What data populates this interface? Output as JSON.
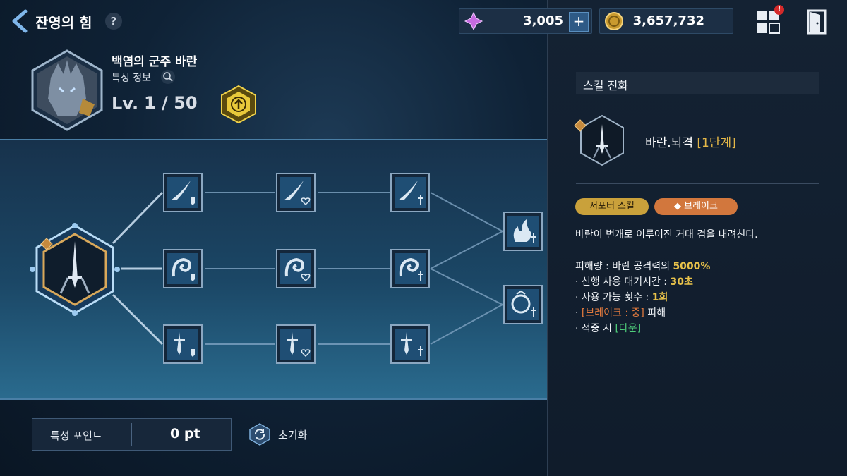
{
  "header": {
    "title": "잔영의 힘",
    "help_label": "?",
    "currency_gem": "3,005",
    "currency_gem_add": "+",
    "currency_gold": "3,657,732",
    "menu_badge": "!"
  },
  "hero": {
    "name": "백염의 군주 바란",
    "sub_label": "특성 정보",
    "level_label": "Lv.",
    "level_value": "1 / 50"
  },
  "bottom": {
    "points_label": "특성 포인트",
    "points_value": "0 pt",
    "reset_label": "초기화"
  },
  "skill_panel": {
    "header": "스킬 진화",
    "skill_name": "바란.뇌격",
    "skill_level": "[1단계]",
    "tag_support": "서포터 스킬",
    "tag_break": "브레이크",
    "description": "바란이 번개로 이루어진 거대 검을 내려친다.",
    "damage_label": "피해량 : 바란 공격력의 ",
    "damage_value": "5000%",
    "cooldown_label": "· 선행 사용 대기시간 : ",
    "cooldown_value": "30초",
    "uses_label": "· 사용 가능 횟수 : ",
    "uses_value": "1회",
    "break_prefix": "· ",
    "break_value": "[브레이크 : 중]",
    "break_suffix": " 피해",
    "hit_label": "· 적중 시 ",
    "hit_value": "[다운]"
  },
  "colors": {
    "accent_gold": "#e8c24a",
    "break_orange": "#d2773d",
    "status_green": "#4fcf7a"
  }
}
